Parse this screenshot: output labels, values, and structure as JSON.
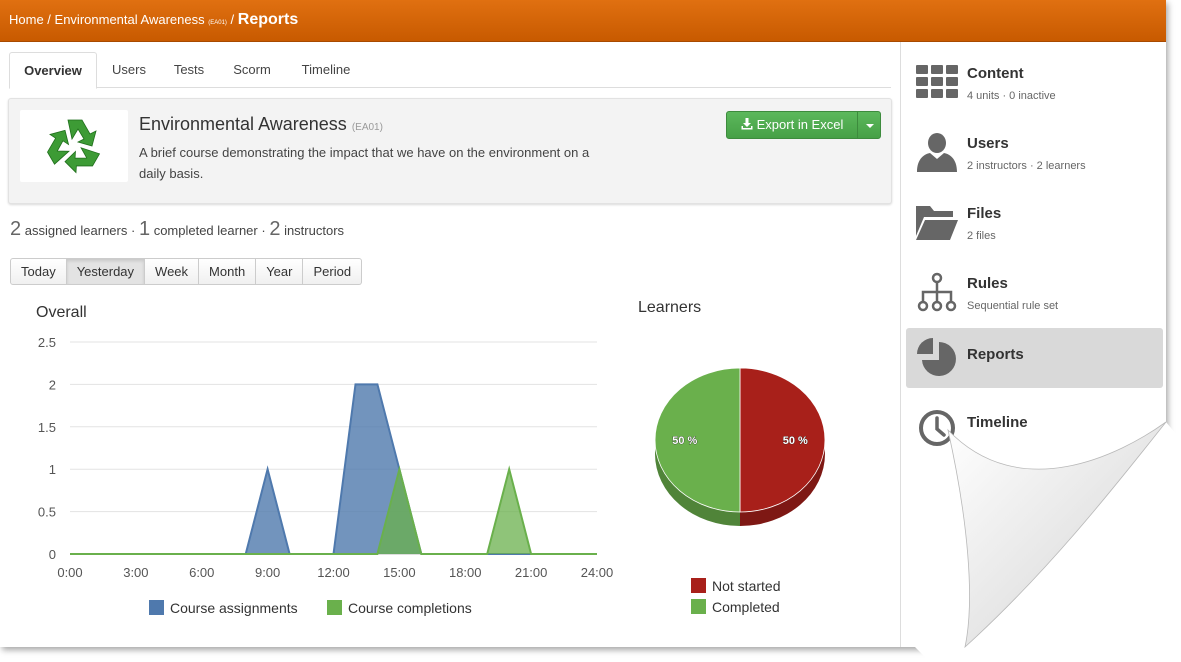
{
  "breadcrumb": {
    "home": "Home",
    "sep": " / ",
    "course": "Environmental Awareness",
    "course_code": "(EA01)",
    "current": "Reports"
  },
  "tabs": [
    {
      "label": "Overview",
      "active": true
    },
    {
      "label": "Users"
    },
    {
      "label": "Tests"
    },
    {
      "label": "Scorm"
    },
    {
      "label": "Timeline"
    }
  ],
  "course": {
    "title": "Environmental Awareness",
    "code": "(EA01)",
    "description": "A brief course demonstrating the impact that we have on the environment on a daily basis.",
    "export_label": "Export in Excel",
    "thumb_icon": "recycle-icon"
  },
  "stats": {
    "assigned_count": "2",
    "assigned_label": "assigned learners",
    "completed_count": "1",
    "completed_label": "completed learner",
    "instructors_count": "2",
    "instructors_label": "instructors",
    "sep": " · "
  },
  "periods": [
    {
      "label": "Today"
    },
    {
      "label": "Yesterday",
      "active": true
    },
    {
      "label": "Week"
    },
    {
      "label": "Month"
    },
    {
      "label": "Year"
    },
    {
      "label": "Period"
    }
  ],
  "chart_data": [
    {
      "type": "area",
      "title": "Overall",
      "x_ticks": [
        "0:00",
        "3:00",
        "6:00",
        "9:00",
        "12:00",
        "15:00",
        "18:00",
        "21:00",
        "24:00"
      ],
      "xlim": [
        0,
        24
      ],
      "y_ticks": [
        "0",
        "0.5",
        "1",
        "1.5",
        "2",
        "2.5"
      ],
      "ylim": [
        0,
        2.5
      ],
      "grid": true,
      "legend": "bottom",
      "series": [
        {
          "name": "Course assignments",
          "color": "#4f79ad",
          "points": [
            [
              0,
              0
            ],
            [
              8,
              0
            ],
            [
              9,
              1
            ],
            [
              10,
              0
            ],
            [
              12,
              0
            ],
            [
              13,
              2
            ],
            [
              14,
              2
            ],
            [
              16,
              0
            ],
            [
              24,
              0
            ]
          ]
        },
        {
          "name": "Course completions",
          "color": "#6ab04c",
          "points": [
            [
              0,
              0
            ],
            [
              14,
              0
            ],
            [
              15,
              1
            ],
            [
              16,
              0
            ],
            [
              19,
              0
            ],
            [
              20,
              1
            ],
            [
              21,
              0
            ],
            [
              24,
              0
            ]
          ]
        }
      ]
    },
    {
      "type": "pie",
      "title": "Learners",
      "legend": "bottom",
      "slices": [
        {
          "label": "Not started",
          "value": 50,
          "display": "50 %",
          "color": "#a8201a"
        },
        {
          "label": "Completed",
          "value": 50,
          "display": "50 %",
          "color": "#6ab04c"
        }
      ]
    }
  ],
  "sidebar": [
    {
      "title": "Content",
      "subtitle": "4 units · 0 inactive",
      "icon": "grid-icon"
    },
    {
      "title": "Users",
      "subtitle": "2 instructors · 2 learners",
      "icon": "user-icon"
    },
    {
      "title": "Files",
      "subtitle": "2 files",
      "icon": "folder-icon"
    },
    {
      "title": "Rules",
      "subtitle": "Sequential rule set",
      "icon": "rules-icon"
    },
    {
      "title": "Reports",
      "subtitle": "",
      "icon": "pie-chart-icon",
      "active": true
    },
    {
      "title": "Timeline",
      "subtitle": "",
      "icon": "clock-icon"
    }
  ]
}
